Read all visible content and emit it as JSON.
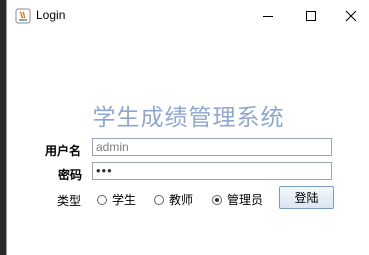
{
  "window": {
    "title": "Login"
  },
  "heading": "学生成绩管理系统",
  "form": {
    "username_label": "用户名",
    "username_value": "admin",
    "password_label": "密码",
    "password_value": "•••",
    "type_label": "类型",
    "types": [
      {
        "label": "学生",
        "selected": false
      },
      {
        "label": "教师",
        "selected": false
      },
      {
        "label": "管理员",
        "selected": true
      }
    ],
    "login_label": "登陆"
  },
  "colors": {
    "heading": "#8fa6cf",
    "field_border": "#9aa5b8"
  }
}
